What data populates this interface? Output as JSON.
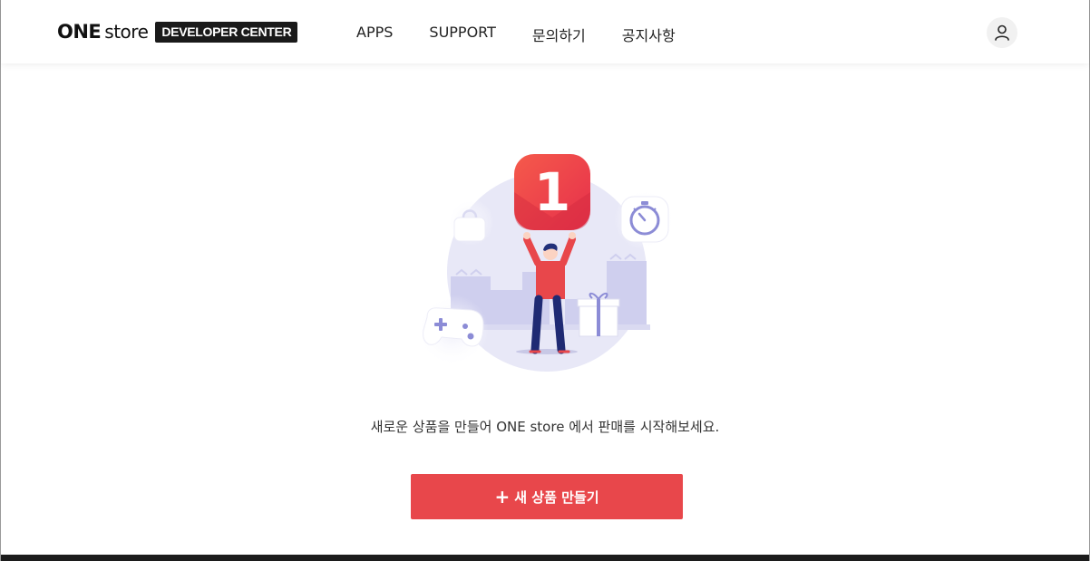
{
  "header": {
    "logo_one": "ONE",
    "logo_store": "store",
    "logo_badge": "DEVELOPER CENTER",
    "nav": [
      {
        "label": "APPS"
      },
      {
        "label": "SUPPORT"
      },
      {
        "label": "문의하기"
      },
      {
        "label": "공지사항"
      }
    ],
    "user_icon": "user-icon"
  },
  "main": {
    "illustration_badge": "1",
    "message": "새로운 상품을 만들어 ONE store 에서 판매를 시작해보세요.",
    "create_button": {
      "plus": "+",
      "label": "새 상품 만들기"
    }
  },
  "colors": {
    "brand": "#e8474b",
    "badge_bg": "#1a1a1a",
    "illustration_circle": "#e6e6f7",
    "illustration_accent": "#8c8cd6"
  }
}
